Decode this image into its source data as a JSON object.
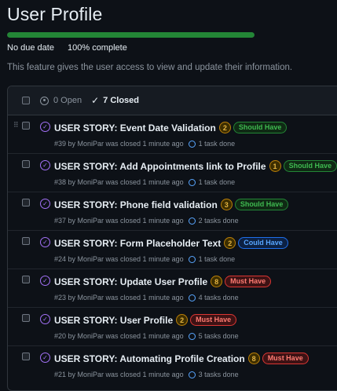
{
  "milestone": {
    "title": "User Profile",
    "progress_fraction": 1.0,
    "due": "No due date",
    "complete": "100% complete",
    "description": "This feature gives the user access to view and update their information."
  },
  "filters": {
    "open": "0 Open",
    "closed": "7 Closed"
  },
  "colors": {
    "progress": "#238636",
    "closed_icon": "#a371f7",
    "should_have": "#3fb950",
    "could_have": "#58a6ff",
    "must_have": "#ff7b72"
  },
  "issues": [
    {
      "title": "USER STORY: Event Date Validation",
      "points": "2",
      "label": "Should Have",
      "label_kind": "should",
      "meta": "#39 by MoniPar was closed 1 minute ago",
      "tasks": "1 task done",
      "drag": true
    },
    {
      "title": "USER STORY: Add Appointments link to Profile",
      "points": "1",
      "label": "Should Have",
      "label_kind": "should",
      "meta": "#38 by MoniPar was closed 1 minute ago",
      "tasks": "1 task done",
      "drag": false
    },
    {
      "title": "USER STORY: Phone field validation",
      "points": "3",
      "label": "Should Have",
      "label_kind": "should",
      "meta": "#37 by MoniPar was closed 1 minute ago",
      "tasks": "2 tasks done",
      "drag": false
    },
    {
      "title": "USER STORY: Form Placeholder Text",
      "points": "2",
      "label": "Could Have",
      "label_kind": "could",
      "meta": "#24 by MoniPar was closed 1 minute ago",
      "tasks": "1 task done",
      "drag": false
    },
    {
      "title": "USER STORY: Update User Profile",
      "points": "8",
      "label": "Must Have",
      "label_kind": "must",
      "meta": "#23 by MoniPar was closed 1 minute ago",
      "tasks": "4 tasks done",
      "drag": false
    },
    {
      "title": "USER STORY: User Profile",
      "points": "2",
      "label": "Must Have",
      "label_kind": "must",
      "meta": "#20 by MoniPar was closed 1 minute ago",
      "tasks": "5 tasks done",
      "drag": false
    },
    {
      "title": "USER STORY: Automating Profile Creation",
      "points": "8",
      "label": "Must Have",
      "label_kind": "must",
      "meta": "#21 by MoniPar was closed 1 minute ago",
      "tasks": "3 tasks done",
      "drag": false
    }
  ]
}
